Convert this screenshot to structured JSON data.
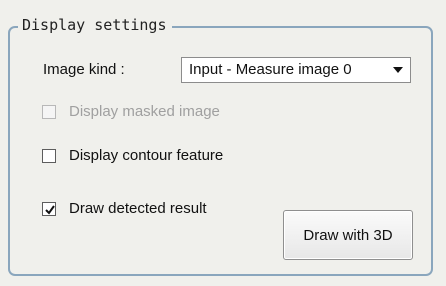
{
  "group": {
    "title": "Display settings"
  },
  "image_kind": {
    "label": "Image kind :",
    "selected": "Input - Measure image 0"
  },
  "options": [
    {
      "label": "Display masked image",
      "checked": false,
      "enabled": false
    },
    {
      "label": "Display contour feature",
      "checked": false,
      "enabled": true
    },
    {
      "label": "Draw detected result",
      "checked": true,
      "enabled": true
    }
  ],
  "buttons": {
    "draw_3d_label": "Draw with 3D"
  },
  "colors": {
    "group_border": "#8aa6bd",
    "panel_background": "#f0f0ec",
    "disabled_text": "#a0a0a0"
  },
  "icons": {
    "dropdown": "chevron-down-icon",
    "checkmark": "checkmark-icon"
  }
}
